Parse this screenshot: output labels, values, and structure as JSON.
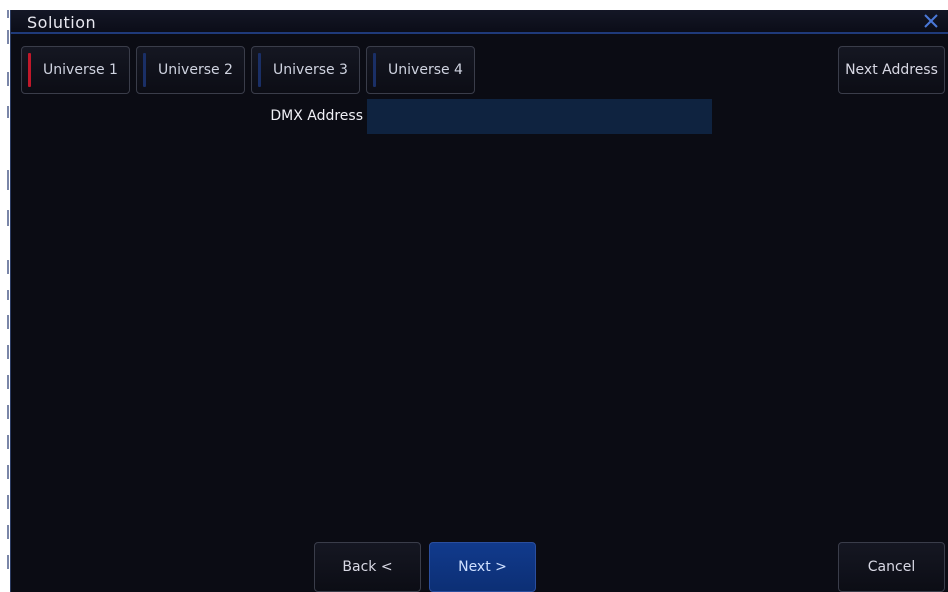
{
  "window": {
    "title": "Solution"
  },
  "tabs": [
    {
      "label": "Universe 1",
      "stripe_color": "#c0182a"
    },
    {
      "label": "Universe 2",
      "stripe_color": "#1a2f66"
    },
    {
      "label": "Universe 3",
      "stripe_color": "#1a2f66"
    },
    {
      "label": "Universe 4",
      "stripe_color": "#1a2f66"
    }
  ],
  "next_address_label": "Next Address",
  "dmx": {
    "label": "DMX Address",
    "value": ""
  },
  "footer": {
    "back_label": "Back <",
    "next_label": "Next >",
    "cancel_label": "Cancel"
  },
  "colors": {
    "background": "#0b0c14",
    "input_bg": "#0f2340",
    "accent_blue": "#113a8c",
    "title_border": "#1f3a7a"
  }
}
